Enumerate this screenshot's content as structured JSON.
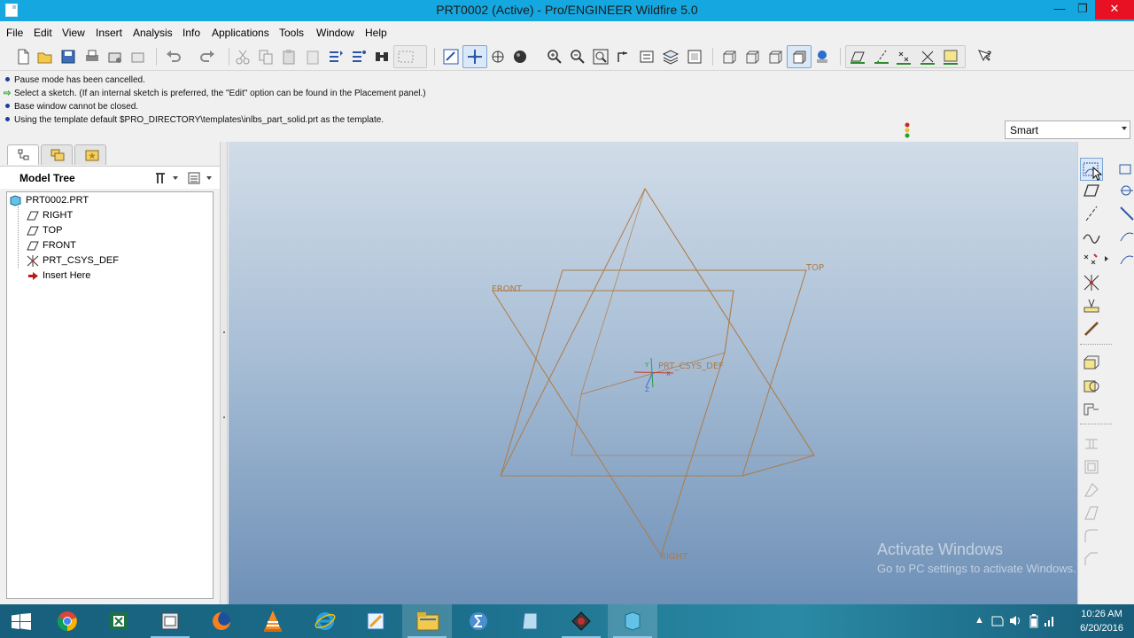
{
  "window": {
    "title": "PRT0002 (Active) - Pro/ENGINEER Wildfire 5.0",
    "minimize": "—",
    "restore": "❐",
    "close": "✕"
  },
  "menu": [
    "File",
    "Edit",
    "View",
    "Insert",
    "Analysis",
    "Info",
    "Applications",
    "Tools",
    "Window",
    "Help"
  ],
  "toolbar": {
    "icons": [
      "new-icon",
      "open-icon",
      "save-icon",
      "print-icon",
      "email-icon",
      "email-link-icon",
      "undo-icon",
      "redo-icon",
      "cut-icon",
      "copy-icon",
      "paste-icon",
      "paste-special-icon",
      "regenerate-icon",
      "regen-manager-icon",
      "model-player-icon",
      "select-box-icon",
      "repaint-icon",
      "spin-center-icon",
      "orient-mode-icon",
      "appearance-icon",
      "zoom-in-icon",
      "zoom-out-icon",
      "refit-icon",
      "reorient-icon",
      "saved-views-icon",
      "layers-icon",
      "view-manager-icon",
      "wireframe-icon",
      "hidden-line-icon",
      "no-hidden-icon",
      "shading-icon",
      "enhanced-realism-icon",
      "plane-display-icon",
      "axis-display-icon",
      "point-display-icon",
      "csys-display-icon",
      "annotation-display-icon",
      "help-icon"
    ]
  },
  "messages": [
    {
      "type": "info",
      "text": "Pause mode has been cancelled."
    },
    {
      "type": "prompt",
      "text": "Select a sketch. (If an internal sketch is preferred, the \"Edit\" option can be found in the Placement panel.)"
    },
    {
      "type": "info",
      "text": "Base window cannot be closed."
    },
    {
      "type": "info",
      "text": "Using the template default $PRO_DIRECTORY\\templates\\inlbs_part_solid.prt as the template."
    }
  ],
  "filter": {
    "selected": "Smart"
  },
  "navigator": {
    "tabs": [
      "model-tree-tab",
      "folder-browser-tab",
      "favorites-tab"
    ],
    "header": "Model Tree",
    "tree": {
      "root": "PRT0002.PRT",
      "children": [
        {
          "label": "RIGHT",
          "icon": "datum-plane-icon"
        },
        {
          "label": "TOP",
          "icon": "datum-plane-icon"
        },
        {
          "label": "FRONT",
          "icon": "datum-plane-icon"
        },
        {
          "label": "PRT_CSYS_DEF",
          "icon": "csys-icon"
        },
        {
          "label": "Insert Here",
          "icon": "insert-arrow-icon"
        }
      ]
    }
  },
  "graphics": {
    "plane_tags": {
      "front": "FRONT",
      "top": "TOP",
      "right": "RIGHT"
    },
    "csys_tag": "PRT_CSYS_DEF",
    "axis_x": "X",
    "axis_y": "Y",
    "axis_z": "Z",
    "datum_color": "#b07a45"
  },
  "watermark": {
    "line1": "Activate Windows",
    "line2": "Go to PC settings to activate Windows."
  },
  "taskbar": {
    "items": [
      "start",
      "chrome",
      "excel",
      "file-explorer-app",
      "firefox",
      "vlc",
      "internet-explorer",
      "notes",
      "folder",
      "sigma",
      "notepad",
      "proe-app",
      "proe-window"
    ],
    "time": "10:26 AM",
    "date": "6/20/2016"
  }
}
